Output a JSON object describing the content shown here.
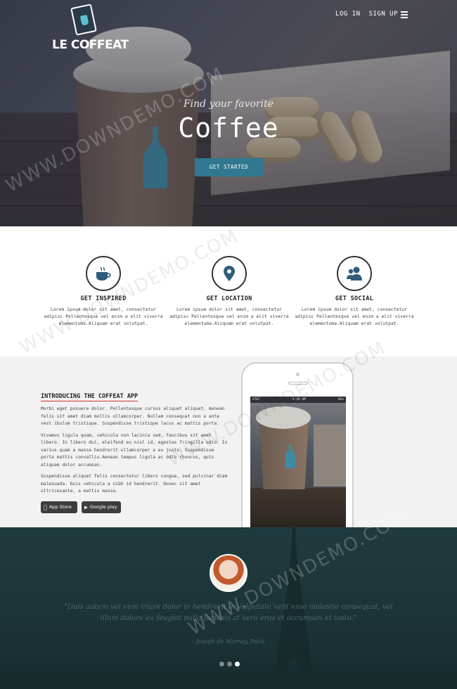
{
  "brand": {
    "logo_text": "LE COFFEAT"
  },
  "nav": {
    "items": [
      "LOG IN",
      "SIGN UP"
    ]
  },
  "hero": {
    "subtitle": "Find your favorite",
    "title": "Coffee",
    "cta_label": "GET STARTED"
  },
  "features": [
    {
      "icon": "coffee-cup-icon",
      "title": "GET INSPIRED",
      "text": "Lorem ipsum dolor sit amet, consectetur adipisc Pellentesque vel enim a elit viverra elementuma.Aliquam erat volutpat."
    },
    {
      "icon": "location-pin-icon",
      "title": "GET LOCATION",
      "text": "Lorem ipsum dolor sit amet, consectetur adipisc Pellentesque vel enim a elit viverra elementuma.Aliquam erat volutpat."
    },
    {
      "icon": "users-icon",
      "title": "GET SOCIAL",
      "text": "Lorem ipsum dolor sit amet, consectetur adipisc Pellentesque vel enim a elit viverra elementuma.Aliquam erat volutpat."
    }
  ],
  "app_section": {
    "title": "INTRODUCING THE COFFEAT APP",
    "paragraphs": [
      "Morbi eget posuere dolor. Pellentesque cursus aliquet aliquet. Aenean felis sit amet diam mollis ullamcorper. Nullam consequat non a ante vest ibulum tristique. Suspendisse tristique lacus ac mattis porta.",
      "Vivamus ligula quam, vehicula non lacinia sed, faucibus sit amet libero. In libero dui, eleifend eu nisl id, egestas fringilla odio. In varius quam a massa hendrerit ullamcorper a eu justo. Suspendisse porta mattis convallis.Aenean tempus ligula ac odio rhoncus, quis aliquam dolor accumsan.",
      "Suspendisse aliquet felis consectetur libero congue, sed pulvinar diam malesuada. Duis vehicula a nibh id hendrerit. Donec sit amet ultricesante, a mattis massa."
    ],
    "stores": [
      {
        "icon": "apple-icon",
        "label": "App Store"
      },
      {
        "icon": "play-icon",
        "label": "Google play"
      }
    ],
    "phone_status": {
      "carrier": "AT&T",
      "time": "4:20 AM",
      "battery": "86%"
    }
  },
  "testimonial": {
    "quote": "\"Duis autem vel eum iriure dolor in hendrerit in vulputate velit esse molestie consequat, vel illum dolore eu feugiat nulla facilisis at vero eros et accumsan et iusto.\"",
    "author": "- Joseph de Mornay, Paris"
  },
  "carousel": {
    "count": 3,
    "active_index": 2
  },
  "watermark": "WWW.DOWNDEMO.COM",
  "colors": {
    "accent": "#2f7890",
    "dark_section": "#1f3b3e"
  }
}
